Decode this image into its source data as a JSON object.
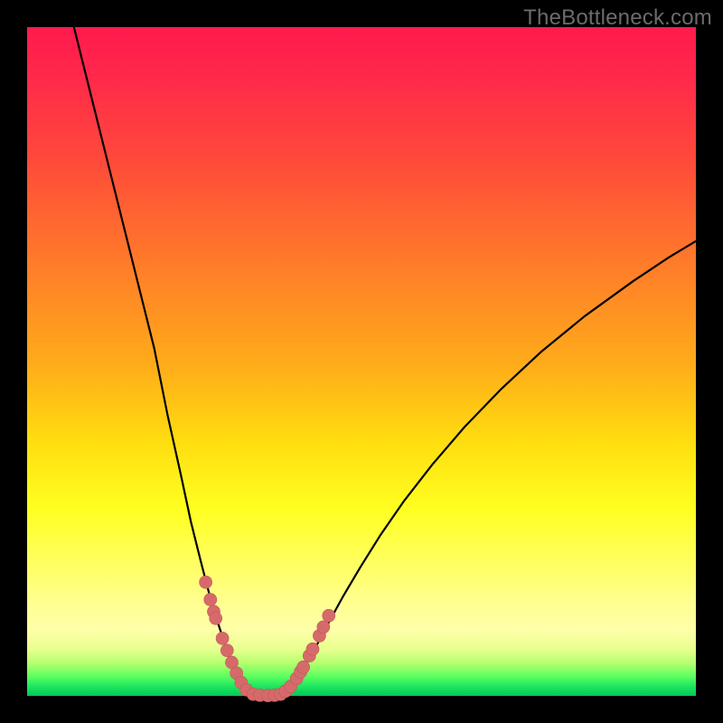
{
  "watermark": "TheBottleneck.com",
  "colors": {
    "curve_stroke": "#000000",
    "dot_fill": "#d66a6a",
    "dot_stroke": "#c05858"
  },
  "chart_data": {
    "type": "line",
    "title": "",
    "xlabel": "",
    "ylabel": "",
    "xlim": [
      0,
      100
    ],
    "ylim": [
      0,
      100
    ],
    "grid": false,
    "legend": false,
    "series": [
      {
        "name": "left-branch",
        "x": [
          7,
          10,
          13,
          16,
          19,
          21,
          23,
          24.5,
          26,
          27.3,
          28.5,
          29.5,
          30.3,
          31,
          31.6,
          32.1,
          32.6,
          33
        ],
        "y": [
          100,
          88,
          76,
          64,
          52,
          42,
          33,
          26,
          20,
          15,
          11,
          8,
          5.5,
          3.6,
          2.2,
          1.2,
          0.5,
          0.15
        ]
      },
      {
        "name": "valley-floor",
        "x": [
          33,
          34,
          35,
          36,
          37,
          38
        ],
        "y": [
          0.15,
          0.05,
          0.02,
          0.02,
          0.05,
          0.15
        ]
      },
      {
        "name": "right-branch",
        "x": [
          38,
          39,
          40.2,
          41.6,
          43.2,
          45,
          47.2,
          49.8,
          52.8,
          56.4,
          60.6,
          65.4,
          70.8,
          76.8,
          83.4,
          90.6,
          96,
          100
        ],
        "y": [
          0.15,
          0.9,
          2.4,
          4.6,
          7.4,
          10.8,
          14.8,
          19.2,
          24,
          29.2,
          34.6,
          40.2,
          45.8,
          51.4,
          56.8,
          62,
          65.6,
          68
        ]
      }
    ],
    "scatter_points": {
      "name": "highlight-dots",
      "x": [
        26.7,
        27.4,
        27.9,
        28.2,
        29.2,
        29.9,
        30.6,
        31.3,
        32.0,
        32.8,
        33.8,
        34.8,
        36.0,
        37.0,
        37.9,
        38.6,
        39.4,
        40.3,
        40.9,
        41.3,
        42.2,
        42.7,
        43.7,
        44.3,
        45.1
      ],
      "y": [
        17.0,
        14.4,
        12.6,
        11.6,
        8.6,
        6.8,
        5.0,
        3.4,
        2.0,
        0.9,
        0.25,
        0.1,
        0.05,
        0.1,
        0.25,
        0.7,
        1.4,
        2.6,
        3.6,
        4.3,
        6.0,
        7.0,
        9.0,
        10.3,
        12.0
      ]
    },
    "dot_radius_pct": 0.95
  }
}
